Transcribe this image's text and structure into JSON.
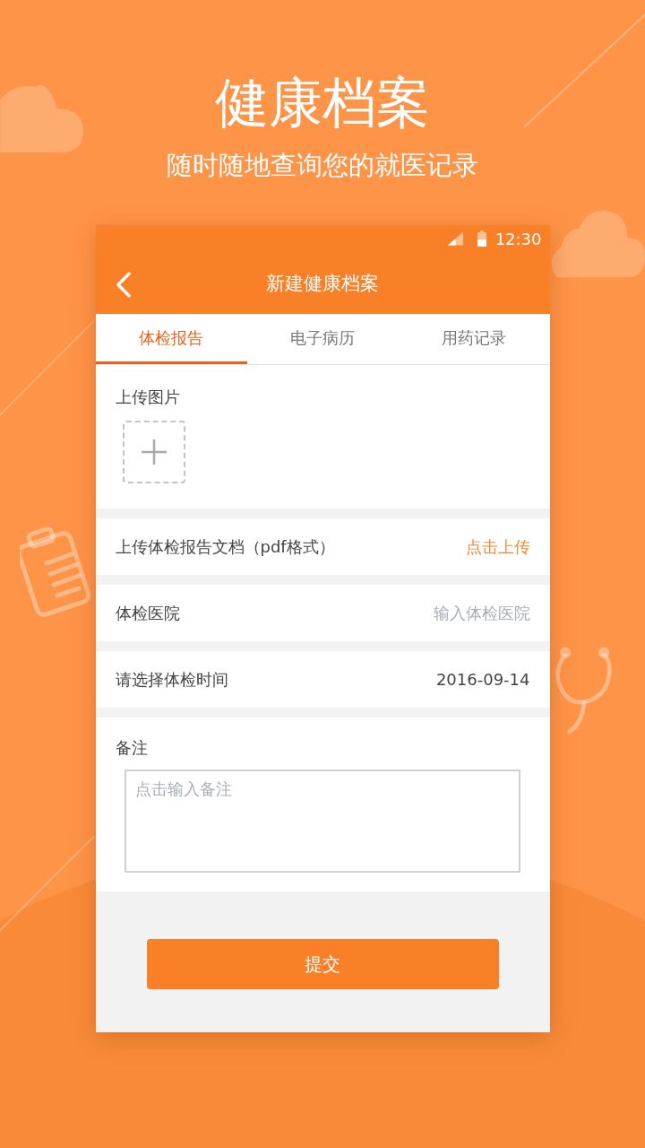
{
  "header": {
    "title": "健康档案",
    "subtitle": "随时随地查询您的就医记录"
  },
  "status_bar": {
    "time": "12:30"
  },
  "app_bar": {
    "title": "新建健康档案"
  },
  "tabs": [
    {
      "label": "体检报告",
      "selected": true
    },
    {
      "label": "电子病历",
      "selected": false
    },
    {
      "label": "用药记录",
      "selected": false
    }
  ],
  "upload_images": {
    "label": "上传图片"
  },
  "fields": [
    {
      "kind": "link",
      "label": "上传体检报告文档（pdf格式）",
      "action": "点击上传"
    },
    {
      "kind": "input",
      "label": "体检医院",
      "placeholder": "输入体检医院"
    },
    {
      "kind": "picker",
      "label": "请选择体检时间",
      "value": "2016-09-14"
    }
  ],
  "remark": {
    "label": "备注",
    "placeholder": "点击输入备注"
  },
  "submit": "提交"
}
